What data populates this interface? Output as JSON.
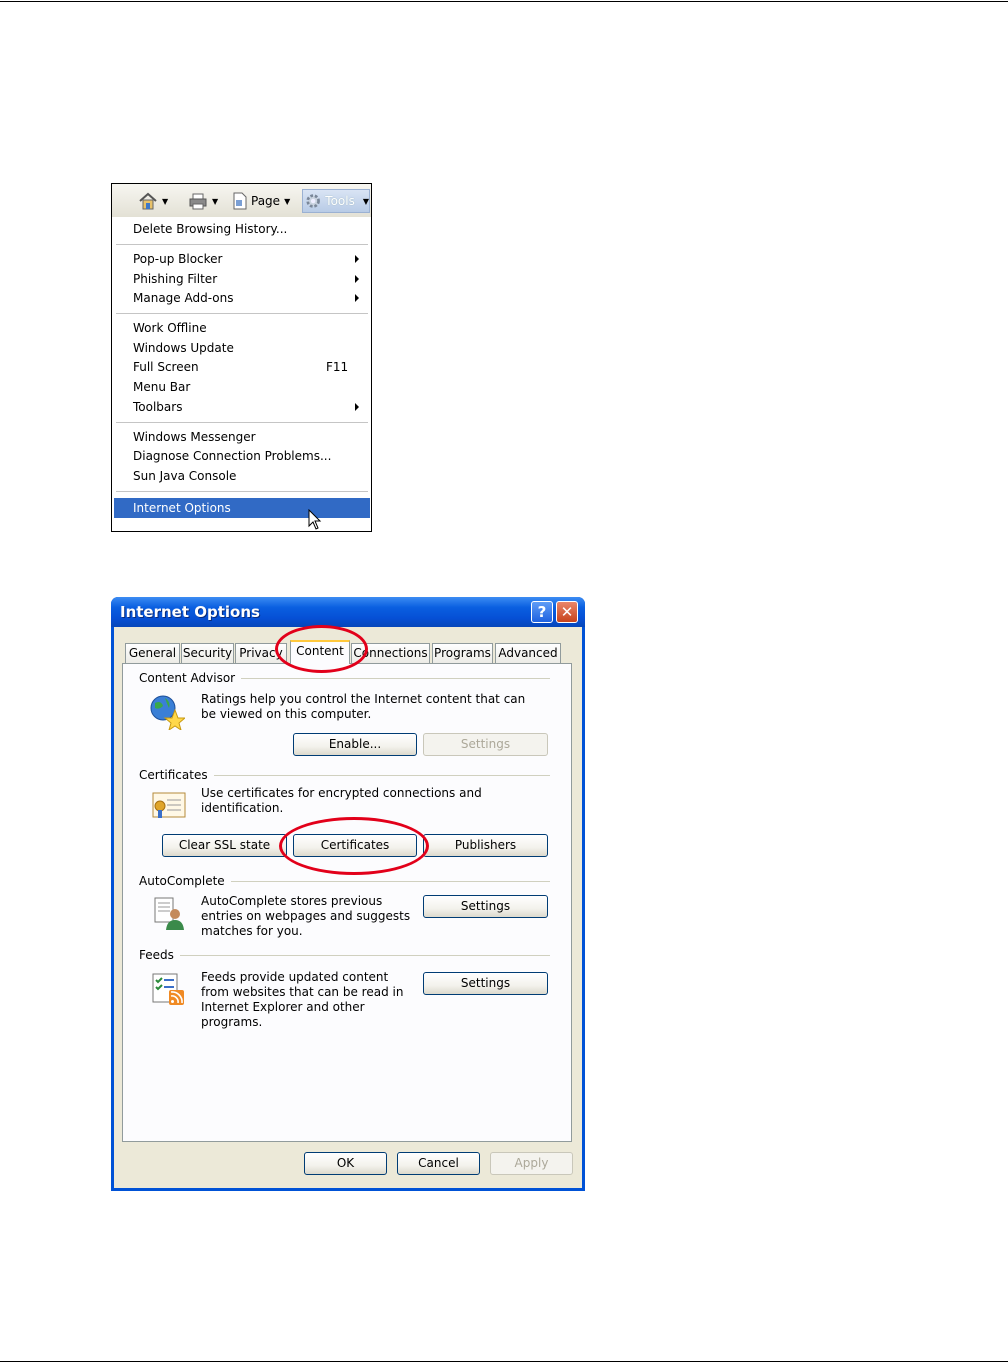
{
  "tools_menu": {
    "toolbar": {
      "home_icon": "home-icon",
      "print_icon": "print-icon",
      "page_label": "Page",
      "tools_label": "Tools"
    },
    "items": [
      {
        "label": "Delete Browsing History...",
        "submenu": false,
        "shortcut": ""
      },
      {
        "label": "Pop-up Blocker",
        "submenu": true,
        "shortcut": ""
      },
      {
        "label": "Phishing Filter",
        "submenu": true,
        "shortcut": ""
      },
      {
        "label": "Manage Add-ons",
        "submenu": true,
        "shortcut": ""
      },
      {
        "label": "Work Offline",
        "submenu": false,
        "shortcut": ""
      },
      {
        "label": "Windows Update",
        "submenu": false,
        "shortcut": ""
      },
      {
        "label": "Full Screen",
        "submenu": false,
        "shortcut": "F11"
      },
      {
        "label": "Menu Bar",
        "submenu": false,
        "shortcut": ""
      },
      {
        "label": "Toolbars",
        "submenu": true,
        "shortcut": ""
      },
      {
        "label": "Windows Messenger",
        "submenu": false,
        "shortcut": ""
      },
      {
        "label": "Diagnose Connection Problems...",
        "submenu": false,
        "shortcut": ""
      },
      {
        "label": "Sun Java Console",
        "submenu": false,
        "shortcut": ""
      },
      {
        "label": "Internet Options",
        "submenu": false,
        "shortcut": "",
        "highlighted": true
      }
    ]
  },
  "dialog": {
    "title": "Internet Options",
    "help_label": "?",
    "close_label": "✕",
    "tabs": [
      "General",
      "Security",
      "Privacy",
      "Content",
      "Connections",
      "Programs",
      "Advanced"
    ],
    "active_tab": "Content",
    "content_advisor": {
      "heading": "Content Advisor",
      "description": "Ratings help you control the Internet content that can be viewed on this computer.",
      "enable_label": "Enable...",
      "settings_label": "Settings"
    },
    "certificates": {
      "heading": "Certificates",
      "description": "Use certificates for encrypted connections and identification.",
      "clear_ssl_label": "Clear SSL state",
      "certificates_label": "Certificates",
      "publishers_label": "Publishers"
    },
    "autocomplete": {
      "heading": "AutoComplete",
      "description": "AutoComplete stores previous entries on webpages and suggests matches for you.",
      "settings_label": "Settings"
    },
    "feeds": {
      "heading": "Feeds",
      "description": "Feeds provide updated content from websites that can be read in Internet Explorer and other programs.",
      "settings_label": "Settings"
    },
    "footer": {
      "ok_label": "OK",
      "cancel_label": "Cancel",
      "apply_label": "Apply"
    }
  },
  "colors": {
    "highlight": "#316ac5",
    "annotation": "#e2001a",
    "xp_title": "#0052d6"
  }
}
